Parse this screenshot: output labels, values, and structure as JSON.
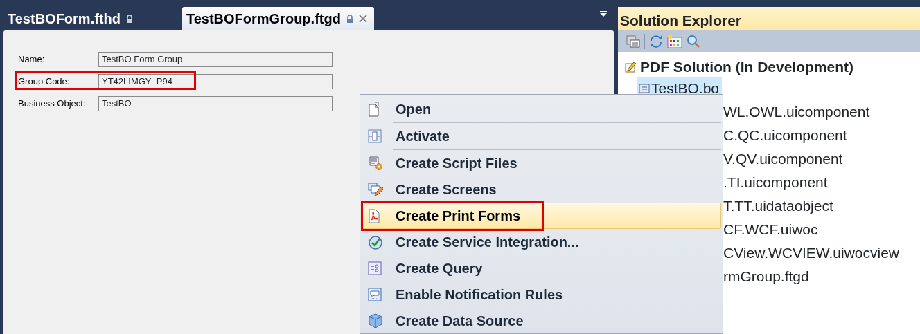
{
  "tabs": [
    {
      "label": "TestBOForm.fthd",
      "selected": false,
      "locked": true,
      "closable": false
    },
    {
      "label": "TestBOFormGroup.ftgd",
      "selected": true,
      "locked": true,
      "closable": true
    }
  ],
  "form": {
    "fields": [
      {
        "label": "Name:",
        "value": "TestBO Form Group",
        "outlined": false
      },
      {
        "label": "Group Code:",
        "value": "YT42LIMGY_P94",
        "outlined": true
      },
      {
        "label": "Business Object:",
        "value": "TestBO",
        "outlined": false
      }
    ]
  },
  "solution_explorer": {
    "title": "Solution Explorer",
    "root": {
      "label": "PDF Solution (In Development)",
      "children": [
        {
          "label": "TestBO.bo",
          "selected": true
        },
        {
          "label": "WL.OWL.uicomponent",
          "selected": false
        },
        {
          "label": "C.QC.uicomponent",
          "selected": false
        },
        {
          "label": "V.QV.uicomponent",
          "selected": false
        },
        {
          "label": ".TI.uicomponent",
          "selected": false
        },
        {
          "label": "T.TT.uidataobject",
          "selected": false
        },
        {
          "label": "CF.WCF.uiwoc",
          "selected": false
        },
        {
          "label": "CView.WCVIEW.uiwocview",
          "selected": false
        },
        {
          "label": "rmGroup.ftgd",
          "selected": false
        }
      ]
    }
  },
  "context_menu": {
    "items": [
      {
        "label": "Open",
        "selected": false,
        "outlined": false,
        "separator_after": true
      },
      {
        "label": "Activate",
        "selected": false,
        "outlined": false,
        "separator_after": true
      },
      {
        "label": "Create Script Files",
        "selected": false,
        "outlined": false,
        "separator_after": false
      },
      {
        "label": "Create Screens",
        "selected": false,
        "outlined": false,
        "separator_after": false
      },
      {
        "label": "Create Print Forms",
        "selected": true,
        "outlined": true,
        "separator_after": false
      },
      {
        "label": "Create Service Integration...",
        "selected": false,
        "outlined": false,
        "separator_after": false
      },
      {
        "label": "Create Query",
        "selected": false,
        "outlined": false,
        "separator_after": false
      },
      {
        "label": "Enable Notification Rules",
        "selected": false,
        "outlined": false,
        "separator_after": false
      },
      {
        "label": "Create Data Source",
        "selected": false,
        "outlined": false,
        "separator_after": false
      }
    ]
  }
}
